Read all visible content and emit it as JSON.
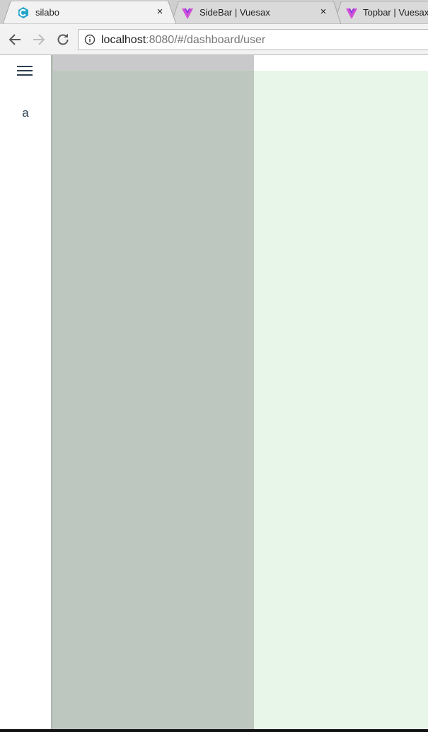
{
  "browser": {
    "tabs": [
      {
        "title": "silabo",
        "icon": "silabo-c-icon",
        "close": "×",
        "active": true
      },
      {
        "title": "SideBar | Vuesax",
        "icon": "vuesax-icon",
        "close": "×",
        "active": false
      },
      {
        "title": "Topbar | Vuesax",
        "icon": "vuesax-icon",
        "close": "",
        "active": false
      }
    ],
    "url_host": "localhost",
    "url_rest": ":8080/#/dashboard/user"
  },
  "sidebar": {
    "menu_icon": "hamburger-menu-icon",
    "item_label": "a"
  },
  "colors": {
    "tabstrip": "#cfcfcf",
    "toolbar": "#f2f2f2",
    "overlay": "#bec7bf",
    "content": "#e8f6ea",
    "silabo_icon": "#26a6c9",
    "vuesax_icon_a": "#d04fd6",
    "vuesax_icon_b": "#8e2de2"
  }
}
